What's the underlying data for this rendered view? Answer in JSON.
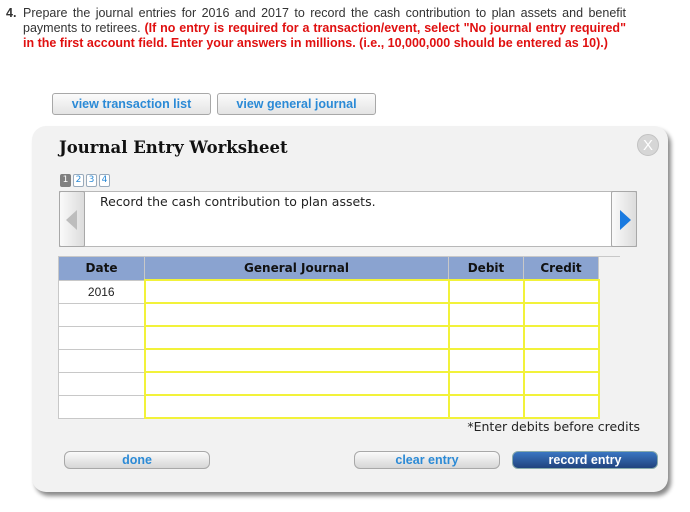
{
  "question": {
    "number": "4.",
    "intro": "Prepare the journal entries for 2016 and 2017 to record the cash contribution to plan assets and benefit payments to retirees.",
    "instruction": "(If no entry is required for a transaction/event, select \"No journal entry required\" in the first account field. Enter your answers in millions. (i.e., 10,000,000 should be entered as 10).)"
  },
  "top_buttons": {
    "view_transaction_list": "view transaction list",
    "view_general_journal": "view general journal"
  },
  "worksheet": {
    "title": "Journal Entry Worksheet",
    "close_icon": "X",
    "pages": [
      "1",
      "2",
      "3",
      "4"
    ],
    "active_page": "1",
    "description": "Record the cash contribution to plan assets.",
    "nav": {
      "prev_icon": "triangle-left",
      "next_icon": "triangle-right"
    },
    "table": {
      "headers": [
        "Date",
        "General Journal",
        "Debit",
        "Credit"
      ],
      "rows": [
        {
          "date": "2016",
          "account": "",
          "debit": "",
          "credit": ""
        },
        {
          "date": "",
          "account": "",
          "debit": "",
          "credit": ""
        },
        {
          "date": "",
          "account": "",
          "debit": "",
          "credit": ""
        },
        {
          "date": "",
          "account": "",
          "debit": "",
          "credit": ""
        },
        {
          "date": "",
          "account": "",
          "debit": "",
          "credit": ""
        },
        {
          "date": "",
          "account": "",
          "debit": "",
          "credit": ""
        }
      ]
    },
    "note": "*Enter debits before credits",
    "buttons": {
      "done": "done",
      "clear_entry": "clear entry",
      "record_entry": "record entry"
    }
  }
}
